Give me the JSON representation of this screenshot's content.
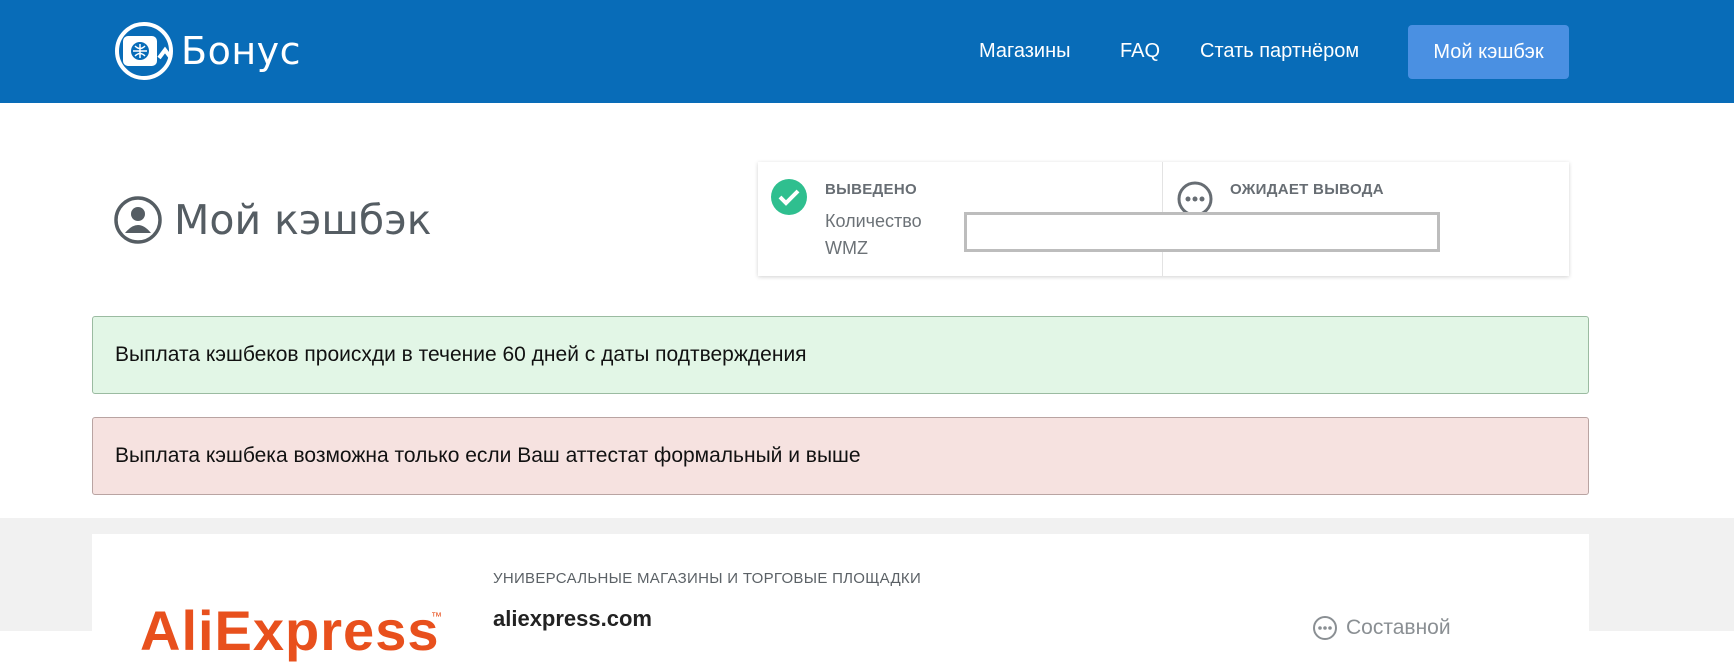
{
  "header": {
    "brand": "Бонус",
    "nav": [
      {
        "label": "Магазины"
      },
      {
        "label": "FAQ"
      },
      {
        "label": "Стать партнёром"
      }
    ],
    "cta_label": "Мой кэшбэк",
    "background": "#086cb8",
    "cta_color": "#4a90e2"
  },
  "page": {
    "title": "Мой кэшбэк"
  },
  "stats": {
    "withdrawn": {
      "heading": "ВЫВЕДЕНО",
      "line1": "Количество",
      "line2": "WMZ",
      "icon": "check-circle-icon",
      "color": "#2fbf8f"
    },
    "pending": {
      "heading": "ОЖИДАЕТ ВЫВОДА",
      "icon": "ellipsis-circle-icon"
    }
  },
  "alerts": {
    "info": "Выплата кэшбеков происхди в течение 60 дней с даты подтверждения",
    "warning": "Выплата кэшбека возможна только если Ваш аттестат формальный и выше"
  },
  "store": {
    "logo_text": "AliExpress",
    "category": "УНИВЕРСАЛЬНЫЕ МАГАЗИНЫ И ТОРГОВЫЕ ПЛОЩАДКИ",
    "name": "aliexpress.com",
    "cashback_type": "Составной",
    "type_icon": "ellipsis-circle-icon",
    "logo_color": "#e8501d"
  }
}
